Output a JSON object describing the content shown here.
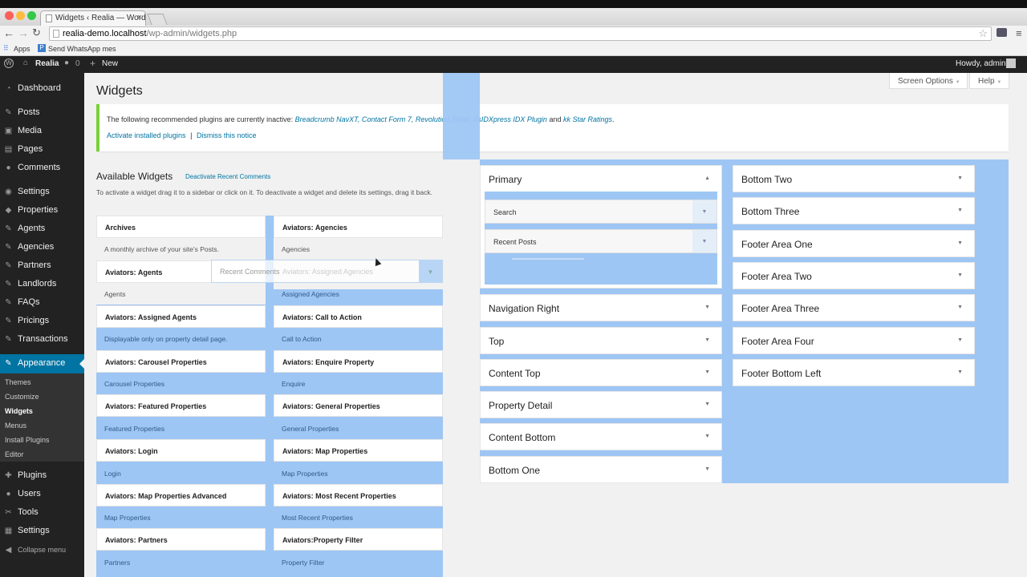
{
  "browser": {
    "tab_title": "Widgets ‹ Realia — WordPress",
    "url_host": "realia-demo.localhost",
    "url_path": "/wp-admin/widgets.php",
    "bookmarks": [
      "Apps",
      "Send WhatsApp mes"
    ]
  },
  "adminbar": {
    "site_name": "Realia",
    "comments_count": "0",
    "new_label": "New",
    "greeting": "Howdy, admin"
  },
  "menu": {
    "items": [
      "Dashboard",
      "Posts",
      "Media",
      "Pages",
      "Comments",
      "Settings",
      "Properties",
      "Agents",
      "Agencies",
      "Partners",
      "Landlords",
      "FAQs",
      "Pricings",
      "Transactions",
      "Appearance",
      "Plugins",
      "Users",
      "Tools",
      "Settings",
      "Collapse menu"
    ],
    "submenu": [
      "Themes",
      "Customize",
      "Widgets",
      "Menus",
      "Install Plugins",
      "Editor"
    ]
  },
  "header": {
    "screen_options": "Screen Options",
    "help": "Help",
    "title": "Widgets"
  },
  "notice": {
    "prefix": "The following recommended plugins are currently inactive: ",
    "plugins": "Breadcrumb NavXT, Contact Form 7, Revolution Slider, dsIDXpress IDX Plugin",
    "and": " and ",
    "last": "kk Star Ratings",
    "suffix": ".",
    "activate": "Activate installed plugins",
    "sep": "|",
    "dismiss": "Dismiss this notice"
  },
  "available": {
    "title": "Available Widgets",
    "deactivate": "Deactivate Recent Comments",
    "desc": "To activate a widget drag it to a sidebar or click on it. To deactivate a widget and delete its settings, drag it back.",
    "left": [
      {
        "title": "Archives",
        "desc": "A monthly archive of your site's Posts."
      },
      {
        "title": "Aviators: Agents",
        "desc": "Agents"
      },
      {
        "title": "Aviators: Assigned Agents",
        "desc": "Displayable only on property detail page."
      },
      {
        "title": "Aviators: Carousel Properties",
        "desc": "Carousel Properties"
      },
      {
        "title": "Aviators: Featured Properties",
        "desc": "Featured Properties"
      },
      {
        "title": "Aviators: Login",
        "desc": "Login"
      },
      {
        "title": "Aviators: Map Properties Advanced",
        "desc": "Map Properties"
      },
      {
        "title": "Aviators: Partners",
        "desc": "Partners"
      }
    ],
    "right": [
      {
        "title": "Aviators: Agencies",
        "desc": "Agencies"
      },
      {
        "title": "Aviators: Assigned Agencies",
        "desc": "Assigned Agencies"
      },
      {
        "title": "Aviators: Call to Action",
        "desc": "Call to Action"
      },
      {
        "title": "Aviators: Enquire Property",
        "desc": "Enquire"
      },
      {
        "title": "Aviators: General Properties",
        "desc": "General Properties"
      },
      {
        "title": "Aviators: Map Properties",
        "desc": "Map Properties"
      },
      {
        "title": "Aviators: Most Recent Properties",
        "desc": "Most Recent Properties"
      },
      {
        "title": "Aviators:Property Filter",
        "desc": "Property Filter"
      }
    ],
    "dragging": "Recent Comments",
    "dragging_behind": "Aviators: Assigned Agencies"
  },
  "sidebars": {
    "col1": [
      "Primary",
      "Navigation Right",
      "Top",
      "Content Top",
      "Property Detail",
      "Content Bottom",
      "Bottom One"
    ],
    "col2": [
      "Bottom Two",
      "Bottom Three",
      "Footer Area One",
      "Footer Area Two",
      "Footer Area Three",
      "Footer Area Four",
      "Footer Bottom Left"
    ],
    "primary_widgets": [
      "Search",
      "Recent Posts"
    ]
  },
  "icons": {
    "arrow_down": "▼",
    "arrow_up": "▲"
  },
  "colors": {
    "admin_dark": "#222222",
    "accent": "#0074a2",
    "drop_highlight": "#9ec6f4",
    "notice_green": "#7ad03a"
  }
}
